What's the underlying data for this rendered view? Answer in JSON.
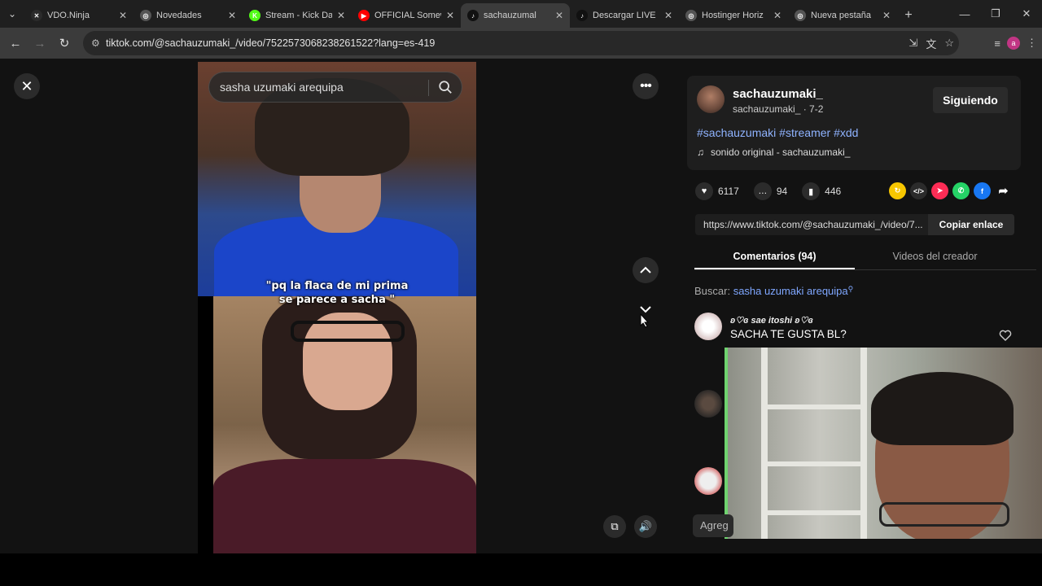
{
  "browser": {
    "tabs": [
      {
        "title": "VDO.Ninja",
        "icon": "vdo-ninja-icon",
        "color": "#2b2b2b",
        "glyph": "✕"
      },
      {
        "title": "Novedades",
        "icon": "globe-icon",
        "color": "#555555",
        "glyph": "◎"
      },
      {
        "title": "Stream - Kick Da",
        "icon": "kick-icon",
        "color": "#53fc18",
        "glyph": "K"
      },
      {
        "title": "OFFICIAL Somew",
        "icon": "youtube-icon",
        "color": "#ff0000",
        "glyph": "▶"
      },
      {
        "title": "sachauzumal",
        "icon": "tiktok-icon",
        "color": "#111111",
        "glyph": "♪",
        "active": true
      },
      {
        "title": "Descargar LIVE ",
        "icon": "tiktok-icon",
        "color": "#111111",
        "glyph": "♪"
      },
      {
        "title": "Hostinger Horiz",
        "icon": "globe-icon",
        "color": "#555555",
        "glyph": "◎"
      },
      {
        "title": "Nueva pestaña",
        "icon": "chrome-icon",
        "color": "#555555",
        "glyph": "◎"
      }
    ],
    "url": "tiktok.com/@sachauzumaki_/video/7522573068238261522?lang=es-419",
    "profile_initial": "a"
  },
  "video": {
    "search_placeholder": "sasha uzumaki arequipa",
    "caption_line1": "\"pq la flaca de mi prima",
    "caption_line2": "se parece a sacha    \""
  },
  "panel": {
    "username": "sachauzumaki_",
    "subline": "sachauzumaki_ · 7-2",
    "follow_label": "Siguiendo",
    "hashtags": "#sachauzumaki #streamer #xdd",
    "sound": "sonido original - sachauzumaki_",
    "likes": "6117",
    "comments": "94",
    "saves": "446",
    "link": "https://www.tiktok.com/@sachauzumaki_/video/7...",
    "copy_label": "Copiar enlace",
    "tab_comments": "Comentarios (94)",
    "tab_creator": "Videos del creador",
    "search_label": "Buscar:",
    "search_term": "sasha uzumaki arequipa",
    "comments_list": [
      {
        "name": "ʚ♡ɞ sae itoshi ʚ♡ɞ",
        "text": "SACHA TE GUSTA BL?"
      }
    ],
    "add_comment": "Agreg"
  }
}
